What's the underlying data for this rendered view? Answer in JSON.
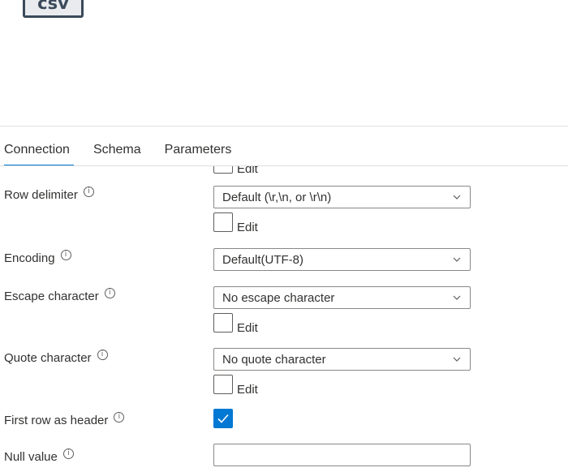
{
  "file_badge": "csv",
  "tabs": [
    {
      "label": "Connection",
      "active": true
    },
    {
      "label": "Schema",
      "active": false
    },
    {
      "label": "Parameters",
      "active": false
    }
  ],
  "edit_label": "Edit",
  "fields": {
    "row_delimiter": {
      "label": "Row delimiter",
      "value": "Default (\\r,\\n, or \\r\\n)"
    },
    "encoding": {
      "label": "Encoding",
      "value": "Default(UTF-8)"
    },
    "escape_character": {
      "label": "Escape character",
      "value": "No escape character"
    },
    "quote_character": {
      "label": "Quote character",
      "value": "No quote character"
    },
    "first_row_as_header": {
      "label": "First row as header",
      "checked": true
    },
    "null_value": {
      "label": "Null value",
      "value": ""
    }
  },
  "info_icon_glyph": "i",
  "colors": {
    "accent": "#0078d4",
    "border": "#8a8886",
    "text": "#323130"
  }
}
